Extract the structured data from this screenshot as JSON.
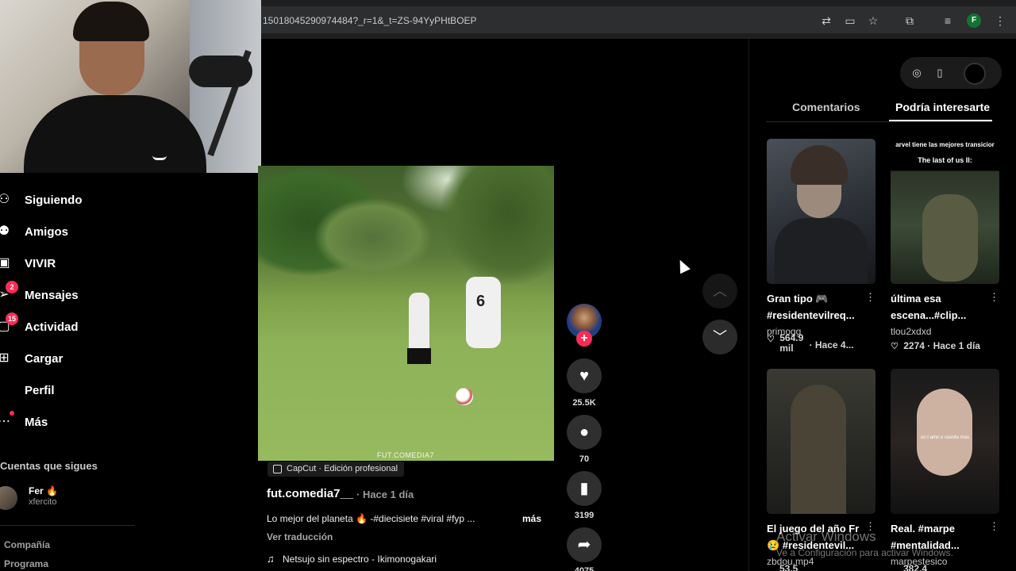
{
  "browser": {
    "url": "15018045290974484?_r=1&_t=ZS-94YyPHtBOEP",
    "profile_initial": "F",
    "icons": [
      "translate-icon",
      "cast-icon",
      "star-icon",
      "extensions-icon",
      "media-queue-icon",
      "menu-dots-icon"
    ]
  },
  "sidebar": {
    "items": [
      {
        "label": "Siguiendo",
        "icon": "following-icon"
      },
      {
        "label": "Amigos",
        "icon": "friends-icon"
      },
      {
        "label": "VIVIR",
        "icon": "live-icon"
      },
      {
        "label": "Mensajes",
        "icon": "messages-icon",
        "badge": "2"
      },
      {
        "label": "Actividad",
        "icon": "activity-icon",
        "badge": "15"
      },
      {
        "label": "Cargar",
        "icon": "upload-icon"
      },
      {
        "label": "Perfil",
        "icon": "profile-icon"
      },
      {
        "label": "Más",
        "icon": "more-icon"
      }
    ],
    "following_title": "Cuentas que sigues",
    "account": {
      "name": "Fer 🔥",
      "username": "xfercito"
    },
    "footer": [
      "Compañía",
      "Programa"
    ]
  },
  "video": {
    "watermark": "FUT.COMEDIA7",
    "jersey_number": "6",
    "capcut_label": "CapCut · Edición profesional",
    "author": "fut.comedia7__",
    "time": "· Hace 1 día",
    "description": "Lo mejor del planeta 🔥 -#diecisiete #viral #fyp ...",
    "more": "más",
    "translate": "Ver traducción",
    "music": "Netsujo sin espectro - Ikimonogakari"
  },
  "actions": {
    "likes": "25.5K",
    "comments": "70",
    "saves": "3199",
    "shares": "4075"
  },
  "right_panel": {
    "tabs": [
      "Comentarios",
      "Podría interesarte"
    ],
    "active_tab": 1,
    "cards": [
      {
        "title": "Gran tipo 🎮 #residentevilreq...",
        "user": "primogg",
        "likes": "564.9 mil",
        "time": "· Hace 4..."
      },
      {
        "title": "última esa escena...#clip...",
        "user": "tlou2xdxd",
        "likes": "2274",
        "time": "· Hace 1 día",
        "caption1": "arvel tiene las mejores transicior",
        "caption2": "The last of us II:"
      },
      {
        "title": "El juego del año Fr 😢 #residentevil...",
        "user": "zbdou.mp4",
        "likes": "53.5"
      },
      {
        "title": "Real. #marpe #mentalidad...",
        "user": "marpestesico",
        "likes": "382.4",
        "overlay": "un t amo e cuenta mas"
      }
    ]
  },
  "windows_activation": {
    "line1": "Activar Windows",
    "line2": "Ve a Configuración para activar Windows."
  }
}
